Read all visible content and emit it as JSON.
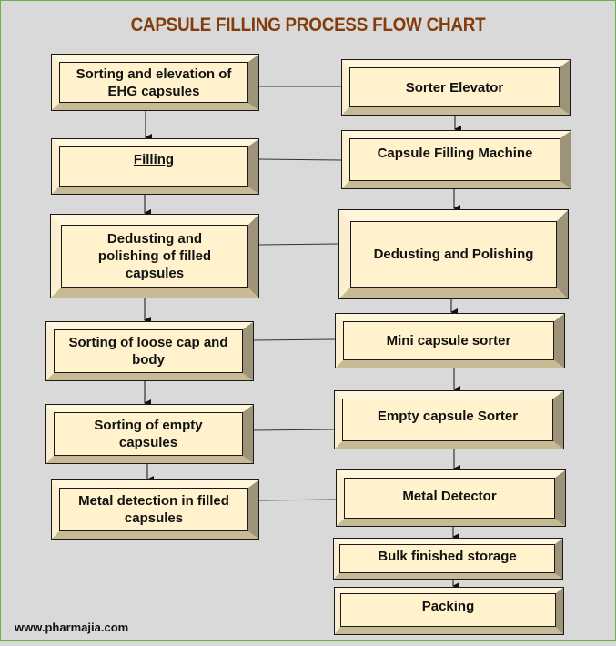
{
  "title": "CAPSULE FILLING PROCESS FLOW CHART",
  "footer": "www.pharmajia.com",
  "colors": {
    "title": "#843c0c",
    "box_fill": "#fff2cc",
    "background": "#d9d9d9",
    "frame_border": "#70ad47"
  },
  "left_steps": [
    {
      "label": "Sorting and elevation of EHG capsules"
    },
    {
      "label": "Filling"
    },
    {
      "label": "Dedusting and polishing of filled capsules"
    },
    {
      "label": "Sorting of loose cap and body"
    },
    {
      "label": "Sorting of empty capsules"
    },
    {
      "label": "Metal detection in filled capsules"
    }
  ],
  "right_steps": [
    {
      "label": "Sorter Elevator"
    },
    {
      "label": "Capsule Filling Machine"
    },
    {
      "label": "Dedusting and Polishing"
    },
    {
      "label": "Mini capsule sorter"
    },
    {
      "label": "Empty capsule Sorter"
    },
    {
      "label": "Metal Detector"
    },
    {
      "label": "Bulk finished storage"
    },
    {
      "label": "Packing"
    }
  ]
}
